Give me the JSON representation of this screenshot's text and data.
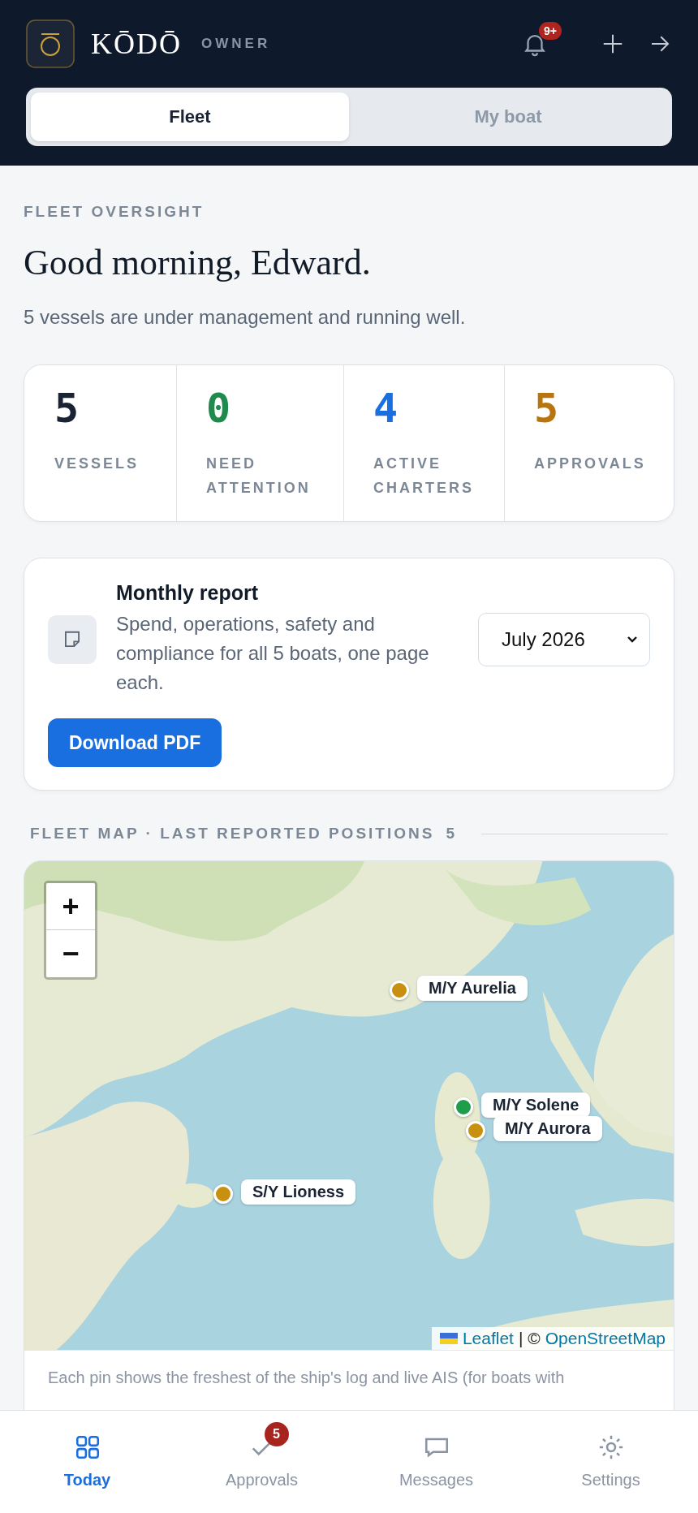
{
  "header": {
    "brand": "KŌDŌ",
    "role": "OWNER",
    "notification_badge": "9+"
  },
  "tabs": [
    {
      "label": "Fleet",
      "selected": true
    },
    {
      "label": "My boat",
      "selected": false
    }
  ],
  "eyebrow": "FLEET OVERSIGHT",
  "greeting": "Good morning, Edward.",
  "summary": "5 vessels are under management and running well.",
  "stats": [
    {
      "value": "5",
      "label": "VESSELS",
      "color": "#1a2333"
    },
    {
      "value": "0",
      "label": "NEED ATTENTION",
      "color": "#1e8a4c"
    },
    {
      "value": "4",
      "label": "ACTIVE CHARTERS",
      "color": "#1a6fe0"
    },
    {
      "value": "5",
      "label": "APPROVALS",
      "color": "#b8740f"
    }
  ],
  "report": {
    "title": "Monthly report",
    "description": "Spend, operations, safety and compliance for all 5 boats, one page each.",
    "month": "July 2026",
    "button": "Download PDF"
  },
  "map_section": {
    "title": "FLEET MAP · LAST REPORTED POSITIONS",
    "count": "5"
  },
  "map": {
    "zoom_in": "+",
    "zoom_out": "−",
    "attribution_links": [
      "Leaflet",
      "OpenStreetMap"
    ],
    "attribution_separator": "| ©",
    "pins": [
      {
        "name": "M/Y Aurelia",
        "color": "#c8900e"
      },
      {
        "name": "M/Y Solene",
        "color": "#1e9e4a"
      },
      {
        "name": "M/Y Aurora",
        "color": "#c8900e"
      },
      {
        "name": "S/Y Lioness",
        "color": "#c8900e"
      }
    ]
  },
  "caption": "Each pin shows the freshest of the ship's log and live AIS (for boats with",
  "bottom_nav": [
    {
      "label": "Today",
      "selected": true
    },
    {
      "label": "Approvals",
      "selected": false,
      "badge": "5"
    },
    {
      "label": "Messages",
      "selected": false
    },
    {
      "label": "Settings",
      "selected": false
    }
  ]
}
